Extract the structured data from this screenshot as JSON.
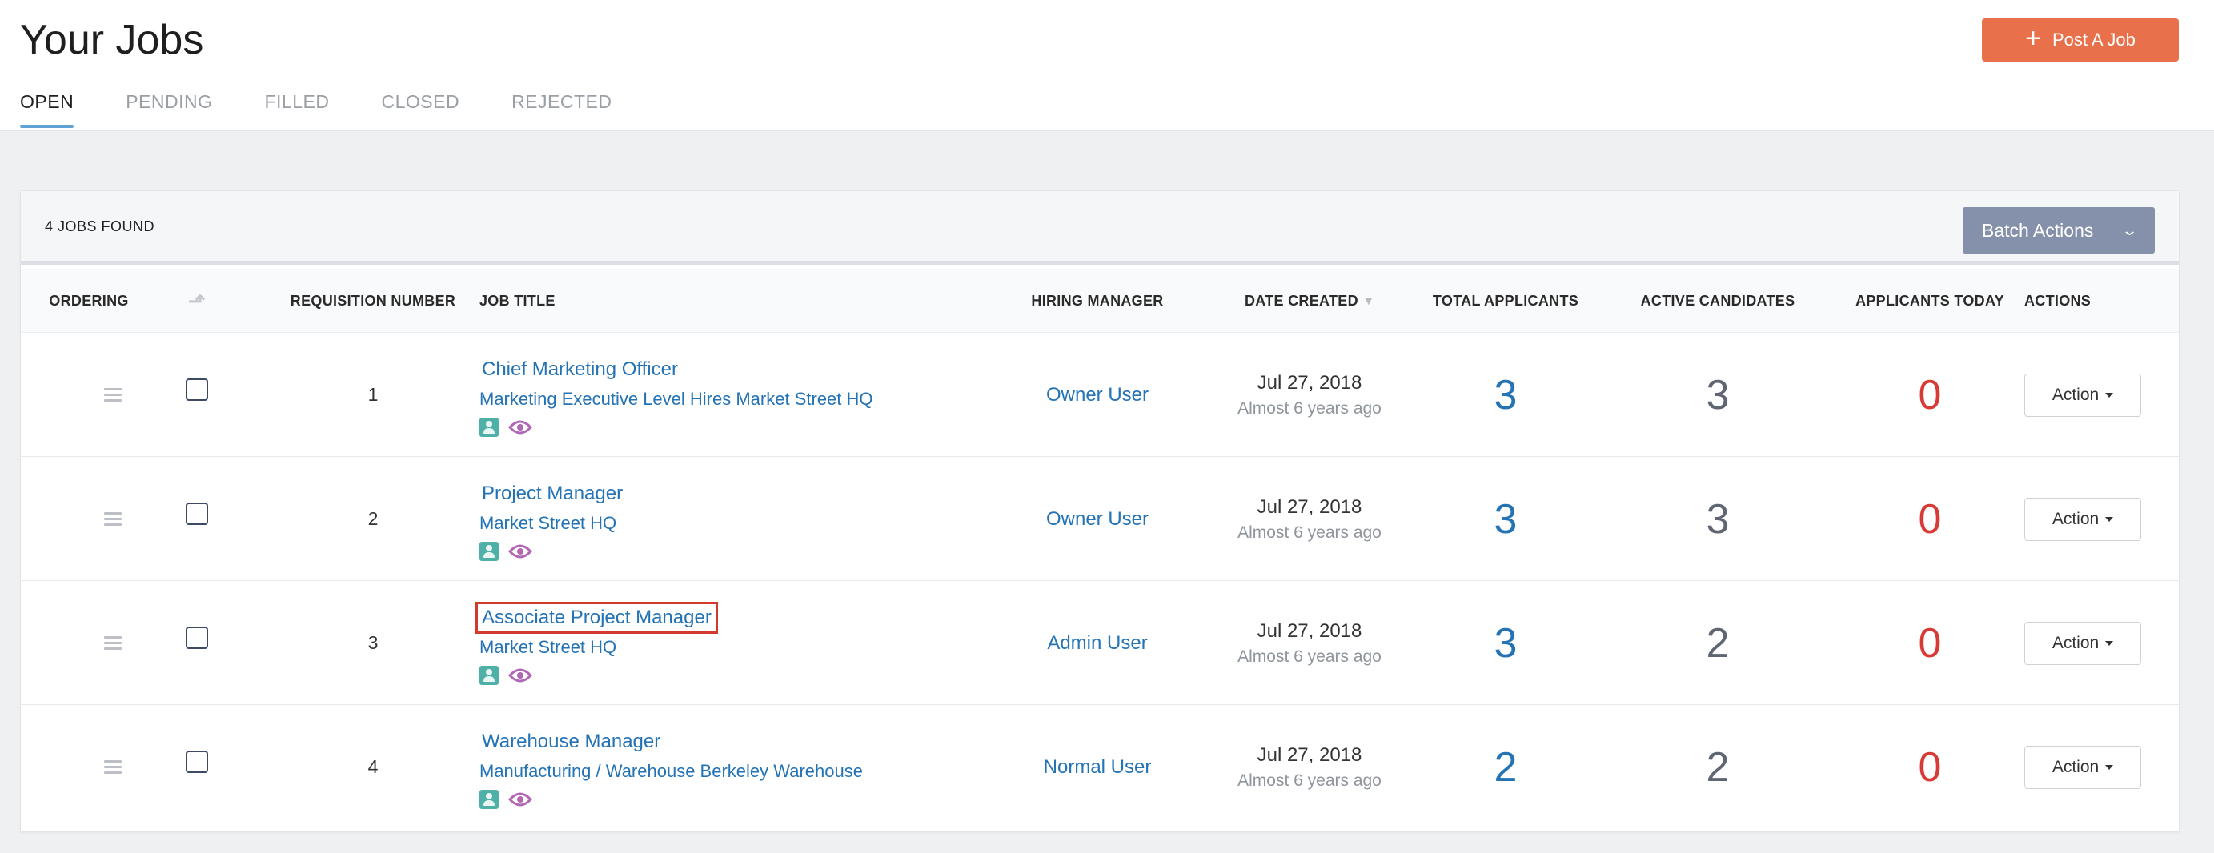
{
  "header": {
    "title": "Your Jobs",
    "post_job_label": "Post A Job",
    "tabs": [
      {
        "label": "OPEN",
        "active": true
      },
      {
        "label": "PENDING",
        "active": false
      },
      {
        "label": "FILLED",
        "active": false
      },
      {
        "label": "CLOSED",
        "active": false
      },
      {
        "label": "REJECTED",
        "active": false
      }
    ]
  },
  "toolbar": {
    "jobs_found": "4 JOBS FOUND",
    "batch_actions_label": "Batch Actions"
  },
  "table": {
    "columns": {
      "ordering": "ORDERING",
      "requisition": "REQUISITION NUMBER",
      "job_title": "JOB TITLE",
      "hiring_manager": "HIRING MANAGER",
      "date_created": "DATE CREATED",
      "total_applicants": "TOTAL APPLICANTS",
      "active_candidates": "ACTIVE CANDIDATES",
      "applicants_today": "APPLICANTS TODAY",
      "actions": "ACTIONS"
    },
    "rows": [
      {
        "requisition": "1",
        "title": "Chief Marketing Officer",
        "subtitle": "Marketing Executive Level Hires Market Street HQ",
        "manager": "Owner User",
        "date": "Jul 27, 2018",
        "date_ago": "Almost 6 years ago",
        "total_applicants": "3",
        "active_candidates": "3",
        "applicants_today": "0",
        "action_label": "Action",
        "highlighted": false
      },
      {
        "requisition": "2",
        "title": "Project Manager",
        "subtitle": "Market Street HQ",
        "manager": "Owner User",
        "date": "Jul 27, 2018",
        "date_ago": "Almost 6 years ago",
        "total_applicants": "3",
        "active_candidates": "3",
        "applicants_today": "0",
        "action_label": "Action",
        "highlighted": false
      },
      {
        "requisition": "3",
        "title": "Associate Project Manager",
        "subtitle": "Market Street HQ",
        "manager": "Admin User",
        "date": "Jul 27, 2018",
        "date_ago": "Almost 6 years ago",
        "total_applicants": "3",
        "active_candidates": "2",
        "applicants_today": "0",
        "action_label": "Action",
        "highlighted": true
      },
      {
        "requisition": "4",
        "title": "Warehouse Manager",
        "subtitle": "Manufacturing / Warehouse Berkeley Warehouse",
        "manager": "Normal User",
        "date": "Jul 27, 2018",
        "date_ago": "Almost 6 years ago",
        "total_applicants": "2",
        "active_candidates": "2",
        "applicants_today": "0",
        "action_label": "Action",
        "highlighted": false
      }
    ]
  },
  "colors": {
    "accent_orange": "#e8704a",
    "link_blue": "#2473b5",
    "batch_gray": "#8591aa",
    "highlight_red": "#d43a2c",
    "zero_red": "#d83a35"
  },
  "icons": {
    "plus": "plus-icon",
    "chevron": "chevron-down-icon",
    "sort": "sort-icon",
    "drag": "drag-handle-icon",
    "person": "person-icon",
    "eye": "eye-icon"
  }
}
